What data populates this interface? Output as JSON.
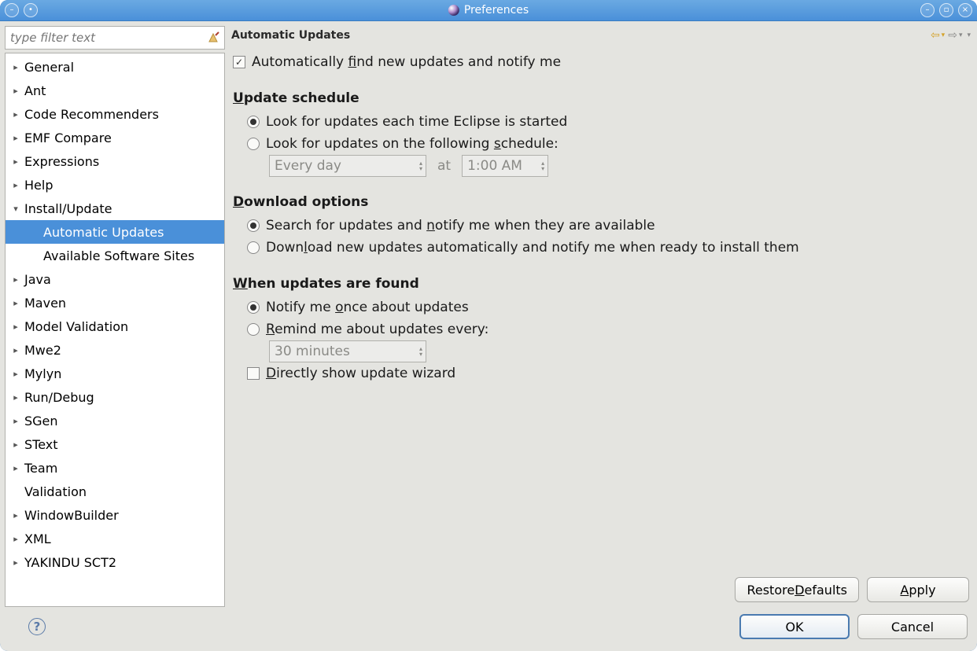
{
  "window": {
    "title": "Preferences"
  },
  "filter": {
    "placeholder": "type filter text"
  },
  "tree": [
    {
      "label": "General",
      "expandable": true
    },
    {
      "label": "Ant",
      "expandable": true
    },
    {
      "label": "Code Recommenders",
      "expandable": true
    },
    {
      "label": "EMF Compare",
      "expandable": true
    },
    {
      "label": "Expressions",
      "expandable": true
    },
    {
      "label": "Help",
      "expandable": true
    },
    {
      "label": "Install/Update",
      "expandable": true,
      "expanded": true,
      "children": [
        {
          "label": "Automatic Updates",
          "selected": true
        },
        {
          "label": "Available Software Sites"
        }
      ]
    },
    {
      "label": "Java",
      "expandable": true
    },
    {
      "label": "Maven",
      "expandable": true
    },
    {
      "label": "Model Validation",
      "expandable": true
    },
    {
      "label": "Mwe2",
      "expandable": true
    },
    {
      "label": "Mylyn",
      "expandable": true
    },
    {
      "label": "Run/Debug",
      "expandable": true
    },
    {
      "label": "SGen",
      "expandable": true
    },
    {
      "label": "SText",
      "expandable": true
    },
    {
      "label": "Team",
      "expandable": true
    },
    {
      "label": "Validation",
      "expandable": false
    },
    {
      "label": "WindowBuilder",
      "expandable": true
    },
    {
      "label": "XML",
      "expandable": true
    },
    {
      "label": "YAKINDU SCT2",
      "expandable": true
    }
  ],
  "page": {
    "title": "Automatic Updates",
    "auto_find": {
      "checked": true,
      "pre": "Automatically ",
      "u": "f",
      "post": "ind new updates and notify me"
    },
    "schedule": {
      "heading_u": "U",
      "heading_rest": "pdate schedule",
      "opt1": "Look for updates each time Eclipse is started",
      "opt2_pre": "Look for updates on the following ",
      "opt2_u": "s",
      "opt2_post": "chedule:",
      "selected": 1,
      "freq": "Every day",
      "at_label": "at",
      "time": "1:00 AM"
    },
    "download": {
      "heading_u": "D",
      "heading_rest": "ownload options",
      "opt1_pre": "Search for updates and ",
      "opt1_u": "n",
      "opt1_post": "otify me when they are available",
      "opt2_pre": "Down",
      "opt2_u": "l",
      "opt2_post": "oad new updates automatically and notify me when ready to install them",
      "selected": 1
    },
    "found": {
      "heading_u": "W",
      "heading_rest": "hen updates are found",
      "opt1_pre": "Notify me ",
      "opt1_u": "o",
      "opt1_post": "nce about updates",
      "opt2_u": "R",
      "opt2_post": "emind me about updates every:",
      "selected": 1,
      "remind": "30 minutes",
      "direct_u": "D",
      "direct_post": "irectly show update wizard",
      "direct_checked": false
    }
  },
  "buttons": {
    "restore_pre": "Restore ",
    "restore_u": "D",
    "restore_post": "efaults",
    "apply_u": "A",
    "apply_post": "pply",
    "ok": "OK",
    "cancel": "Cancel"
  }
}
